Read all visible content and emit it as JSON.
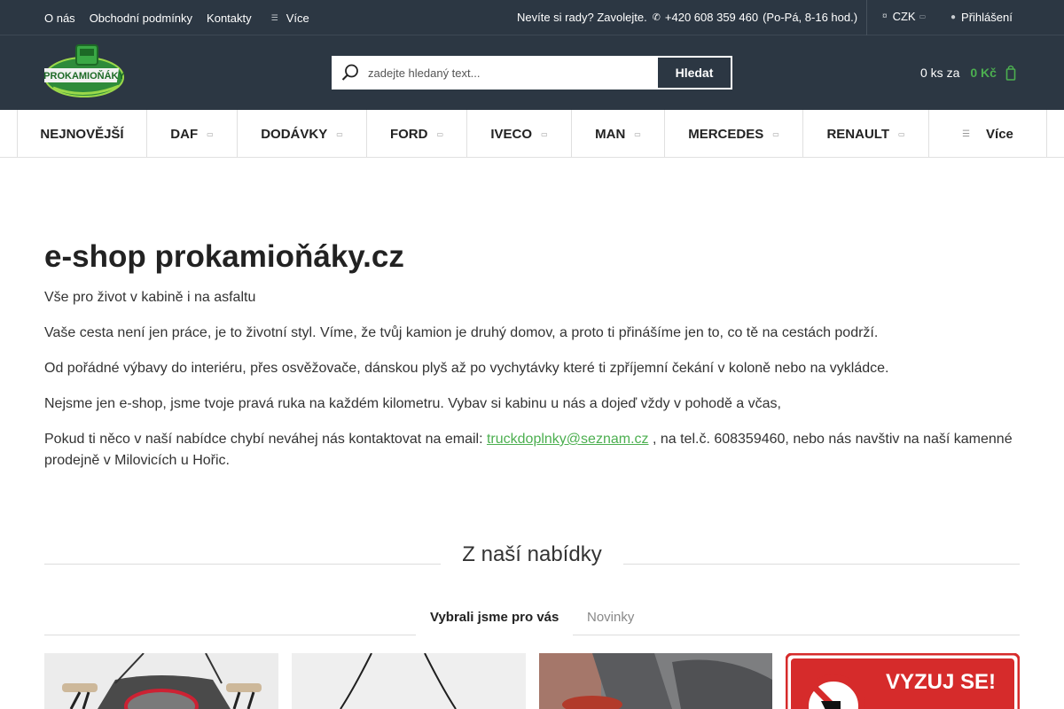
{
  "topbar": {
    "links": [
      "O nás",
      "Obchodní podmínky",
      "Kontakty"
    ],
    "more_label": "Více",
    "contact_text": "Nevíte si rady? Zavolejte.",
    "phone": "+420 608 359 460",
    "hours": "(Po-Pá, 8-16 hod.)",
    "currency": "CZK",
    "login": "Přihlášení"
  },
  "header": {
    "logo_text": "PROKAMIOŇÁKY",
    "search": {
      "placeholder": "zadejte hledaný text...",
      "button_label": "Hledat"
    },
    "cart": {
      "count_text": "0 ks za",
      "price": "0 Kč"
    }
  },
  "nav": {
    "items": [
      {
        "label": "NEJNOVĚJŠÍ"
      },
      {
        "label": "DAF"
      },
      {
        "label": "DODÁVKY"
      },
      {
        "label": "FORD"
      },
      {
        "label": "IVECO"
      },
      {
        "label": "MAN"
      },
      {
        "label": "MERCEDES"
      },
      {
        "label": "RENAULT"
      }
    ],
    "more_label": "Více"
  },
  "content": {
    "title": "e-shop prokamioňáky.cz",
    "p1": "Vše pro život v kabině i na asfaltu",
    "p2": "Vaše cesta není jen práce, je to životní styl. Víme, že tvůj kamion je druhý domov, a proto ti přinášíme jen to, co tě na cestách podrží.",
    "p3": "Od pořádné výbavy do interiéru, přes osvěžovače, dánskou plyš až po vychytávky které ti zpříjemní čekání v koloně nebo na vykládce.",
    "p4": "Nejsme jen e-shop, jsme tvoje pravá ruka na každém kilometru. Vybav si kabinu u nás a dojeď vždy v pohodě a včas,",
    "p5_before": "Pokud ti něco v naší nabídce chybí neváhej nás kontaktovat na email:",
    "p5_email": "truckdoplnky@seznam.cz",
    "p5_after": ", na tel.č. 608359460, nebo nás navštiv na naší kamenné prodejně v Milovicích u Hořic."
  },
  "section": {
    "title": "Z naší nabídky",
    "tabs": [
      "Vybrali jsme pro vás",
      "Novinky"
    ]
  },
  "products": {
    "sign_text": "VYZUJ SE!"
  },
  "colors": {
    "header_bg": "#2c3743",
    "accent_green": "#4caf50",
    "sign_red": "#d62b2b"
  }
}
